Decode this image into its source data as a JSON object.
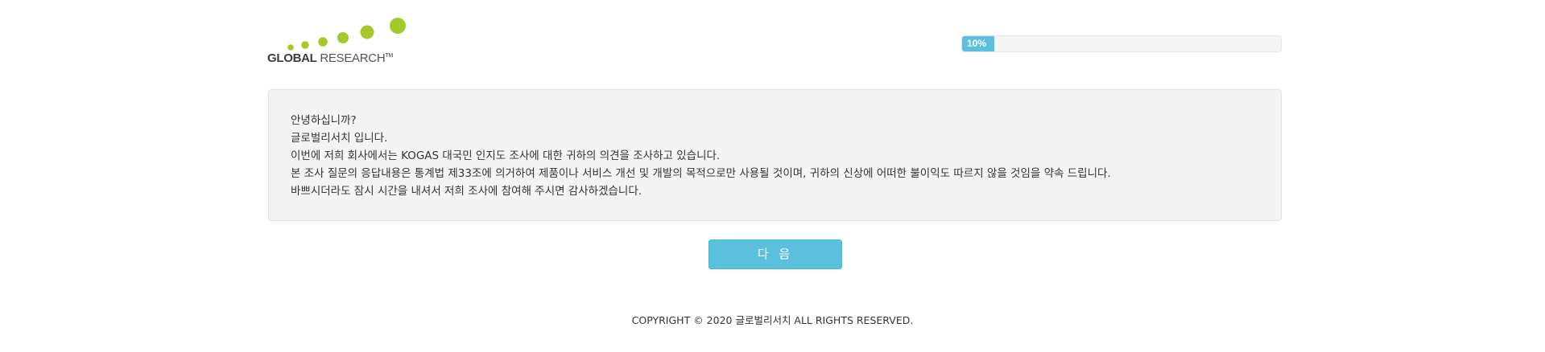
{
  "logo": {
    "text_bold": "GLOBAL",
    "text_light": " RESEARCH",
    "trademark": "TM",
    "accent_color": "#a5c92a"
  },
  "progress": {
    "percent": 10,
    "label": "10%",
    "color": "#5bc0de"
  },
  "message": {
    "lines": [
      "안녕하십니까?",
      "글로벌리서치 입니다.",
      "이번에 저희 회사에서는 KOGAS 대국민 인지도 조사에 대한 귀하의 의견을 조사하고 있습니다.",
      "본 조사 질문의 응답내용은 통계법 제33조에 의거하여 제품이나 서비스 개선 및 개발의 목적으로만 사용될 것이며, 귀하의 신상에 어떠한 불이익도 따르지 않을 것임을 약속 드립니다.",
      "바쁘시더라도 잠시 시간을 내셔서 저희 조사에 참여해 주시면 감사하겠습니다."
    ]
  },
  "next_button": {
    "label": "다 음"
  },
  "footer": {
    "copyright": "COPYRIGHT © 2020 글로벌리서치 ALL RIGHTS RESERVED."
  }
}
